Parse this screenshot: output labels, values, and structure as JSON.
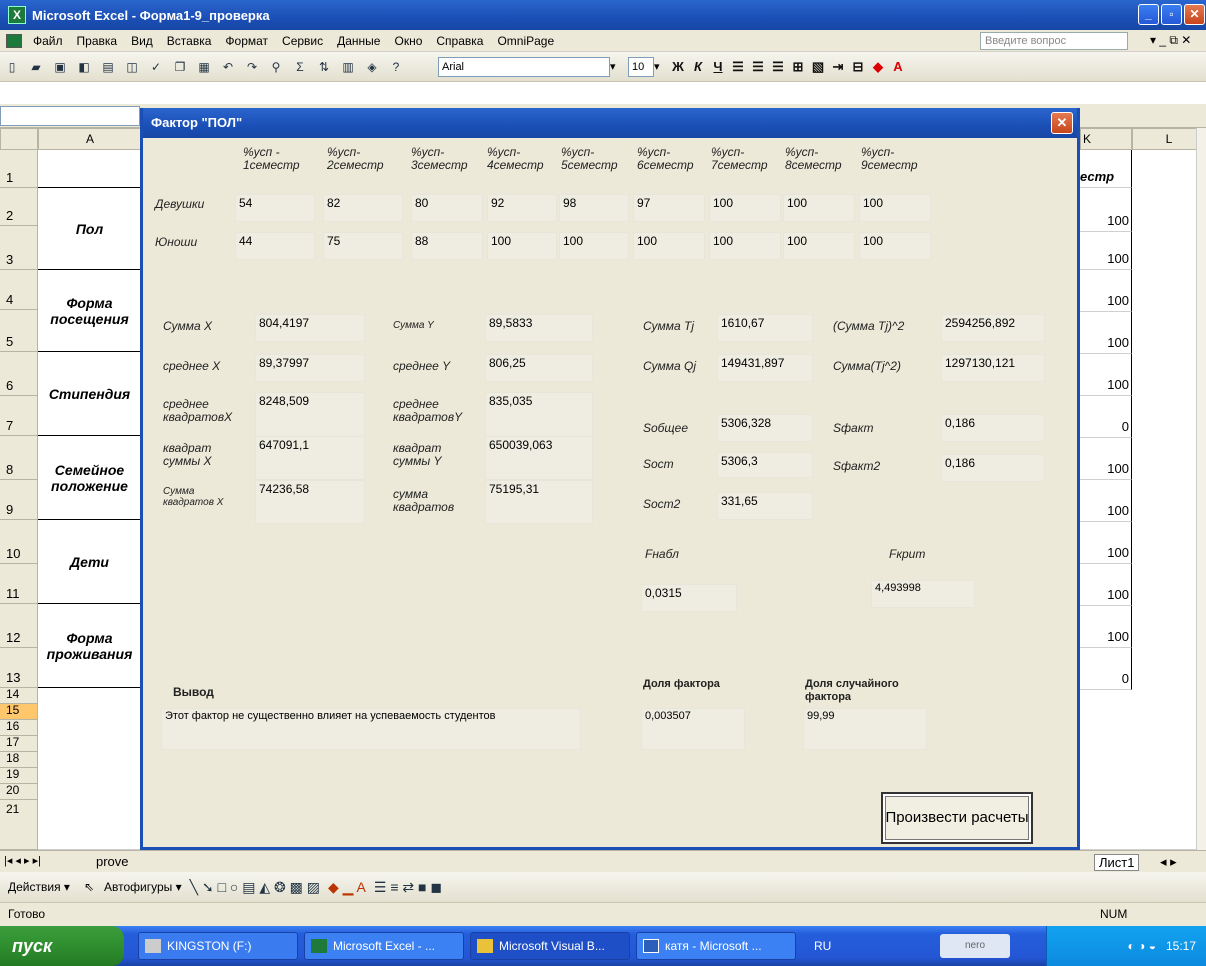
{
  "window": {
    "title": "Microsoft Excel - Форма1-9_проверка"
  },
  "menu": [
    "Файл",
    "Правка",
    "Вид",
    "Вставка",
    "Формат",
    "Сервис",
    "Данные",
    "Окно",
    "Справка",
    "OmniPage"
  ],
  "help_placeholder": "Введите вопрос",
  "toolbar": {
    "font": "Arial",
    "size": "10"
  },
  "columns": {
    "a": "A",
    "k": "K",
    "l": "L"
  },
  "rows": [
    "1",
    "2",
    "3",
    "4",
    "5",
    "6",
    "7",
    "8",
    "9",
    "10",
    "11",
    "12",
    "13",
    "14",
    "15",
    "16",
    "17",
    "18",
    "19",
    "20",
    "21"
  ],
  "col_a_groups": [
    {
      "label": "Пол"
    },
    {
      "label": "Форма посещения"
    },
    {
      "label": "Стипендия"
    },
    {
      "label": "Семейное положение"
    },
    {
      "label": "Дети"
    },
    {
      "label": "Форма проживания"
    }
  ],
  "col_k": {
    "header": "естр",
    "values": [
      "100",
      "100",
      "100",
      "100",
      "100",
      "0",
      "100",
      "100",
      "100",
      "100",
      "100",
      "0"
    ]
  },
  "sheets": {
    "first": "prove",
    "last": "Лист1"
  },
  "drawbar": {
    "actions": "Действия ▾",
    "autoshapes": "Автофигуры ▾"
  },
  "status": {
    "left": "Готово",
    "num": "NUM"
  },
  "taskbar": {
    "start": "пуск",
    "items": [
      "KINGSTON (F:)",
      "Microsoft Excel - ...",
      "Microsoft Visual B...",
      "катя - Microsoft ..."
    ],
    "lang": "RU",
    "nero": "nero",
    "time": "15:17"
  },
  "dialog": {
    "title": "Фактор \"ПОЛ\"",
    "semesters": [
      "%усп - 1семестр",
      "%усп- 2семестр",
      "%усп- 3семестр",
      "%усп- 4семестр",
      "%усп- 5семестр",
      "%усп- 6семестр",
      "%усп- 7семестр",
      "%усп- 8семестр",
      "%усп- 9семестр"
    ],
    "rows": [
      {
        "label": "Девушки",
        "values": [
          "54",
          "82",
          "80",
          "92",
          "98",
          "97",
          "100",
          "100",
          "100"
        ]
      },
      {
        "label": "Юноши",
        "values": [
          "44",
          "75",
          "88",
          "100",
          "100",
          "100",
          "100",
          "100",
          "100"
        ]
      }
    ],
    "stats": {
      "sum_x": {
        "label": "Сумма X",
        "value": "804,4197"
      },
      "mean_x": {
        "label": "среднее X",
        "value": "89,37997"
      },
      "mean_sq_x": {
        "label": "среднее квадратовX",
        "value": "8248,509"
      },
      "sq_sum_x": {
        "label": "квадрат суммы X",
        "value": "647091,1"
      },
      "sum_sq_x": {
        "label": "Сумма квадратов X",
        "value": "74236,58"
      },
      "sum_y": {
        "label": "Сумма Y",
        "value": "89,5833"
      },
      "mean_y": {
        "label": "среднее Y",
        "value": "806,25"
      },
      "mean_sq_y": {
        "label": "среднее квадратовY",
        "value": "835,035"
      },
      "sq_sum_y": {
        "label": "квадрат суммы Y",
        "value": "650039,063"
      },
      "sum_sq_y": {
        "label": "сумма квадратов",
        "value": "75195,31"
      },
      "sum_tj": {
        "label": "Сумма Tj",
        "value": "1610,67"
      },
      "sum_qj": {
        "label": "Сумма Qj",
        "value": "149431,897"
      },
      "s_total": {
        "label": "Sобщее",
        "value": "5306,328"
      },
      "s_ost": {
        "label": "Sост",
        "value": "5306,3"
      },
      "s_ost2": {
        "label": "Sост2",
        "value": "331,65"
      },
      "sum_tj_sq": {
        "label": "(Сумма Tj)^2",
        "value": "2594256,892"
      },
      "sum_tj2": {
        "label": "Сумма(Tj^2)",
        "value": "1297130,121"
      },
      "s_fact": {
        "label": "Sфакт",
        "value": "0,186"
      },
      "s_fact2": {
        "label": "Sфакт2",
        "value": "0,186"
      },
      "f_obs": {
        "label": "Fнабл",
        "value": "0,0315"
      },
      "f_crit": {
        "label": "Fкрит",
        "value": "4,493998"
      }
    },
    "conclusion": {
      "label": "Вывод",
      "text": "Этот фактор не существенно влияет на успеваемость студентов"
    },
    "share_factor": {
      "label": "Доля фактора",
      "value": "0,003507"
    },
    "share_random": {
      "label": "Доля случайного фактора",
      "value": "99,99"
    },
    "compute_button": "Произвести расчеты"
  }
}
